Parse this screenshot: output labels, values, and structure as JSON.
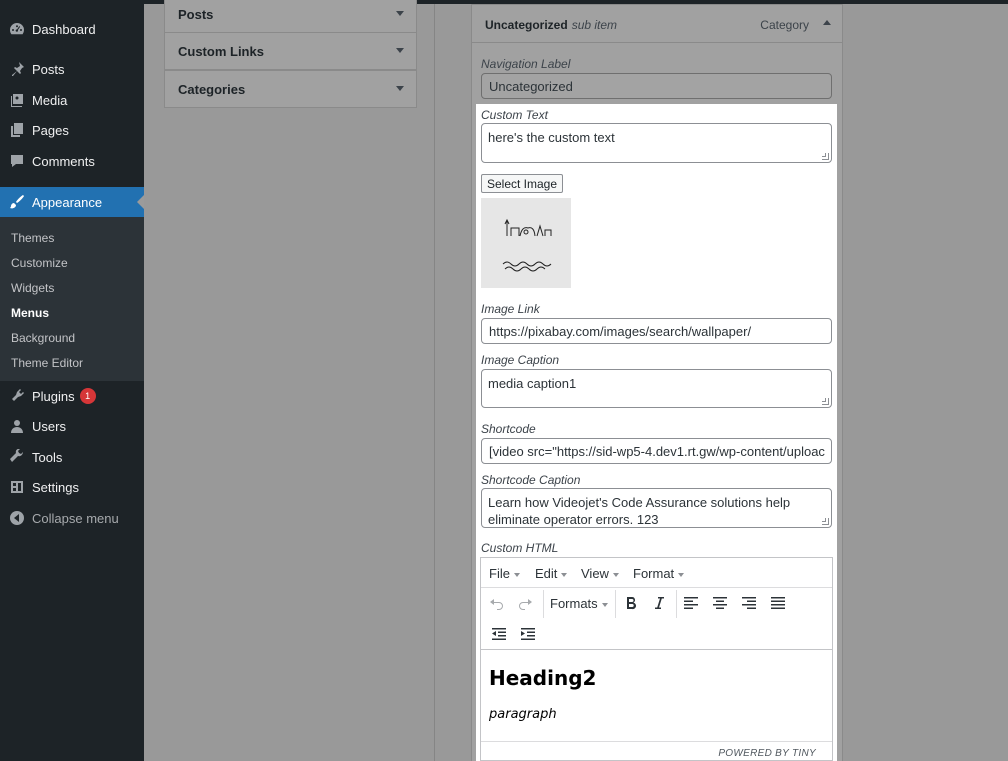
{
  "sidebar": {
    "items": [
      {
        "label": "Dashboard",
        "icon": "dashboard-icon"
      },
      {
        "label": "Posts",
        "icon": "pin-icon"
      },
      {
        "label": "Media",
        "icon": "media-icon"
      },
      {
        "label": "Pages",
        "icon": "pages-icon"
      },
      {
        "label": "Comments",
        "icon": "comment-icon"
      },
      {
        "label": "Appearance",
        "icon": "brush-icon"
      },
      {
        "label": "Plugins",
        "icon": "plugin-icon",
        "badge": "1"
      },
      {
        "label": "Users",
        "icon": "user-icon"
      },
      {
        "label": "Tools",
        "icon": "wrench-icon"
      },
      {
        "label": "Settings",
        "icon": "settings-icon"
      },
      {
        "label": "Collapse menu",
        "icon": "collapse-icon"
      }
    ],
    "submenu": [
      "Themes",
      "Customize",
      "Widgets",
      "Menus",
      "Background",
      "Theme Editor"
    ],
    "active_color": "#2271b1"
  },
  "accordion": {
    "sections": [
      "Posts",
      "Custom Links",
      "Categories"
    ]
  },
  "menu_item": {
    "title": "Uncategorized",
    "subtitle": "sub item",
    "type": "Category",
    "nav_label_label": "Navigation Label",
    "nav_label_value": "Uncategorized",
    "custom_text_label": "Custom Text",
    "custom_text_value": "here's the custom text",
    "select_image_label": "Select Image",
    "image_link_label": "Image Link",
    "image_link_value": "https://pixabay.com/images/search/wallpaper/",
    "image_caption_label": "Image Caption",
    "image_caption_value": "media caption1",
    "shortcode_label": "Shortcode",
    "shortcode_value": "[video src=\"https://sid-wp5-4.dev1.rt.gw/wp-content/uploac",
    "shortcode_caption_label": "Shortcode Caption",
    "shortcode_caption_value": "Learn how Videojet's Code Assurance solutions help eliminate operator errors. 123",
    "custom_html_label": "Custom HTML"
  },
  "editor": {
    "menus": [
      "File",
      "Edit",
      "View",
      "Format"
    ],
    "formats_label": "Formats",
    "heading": "Heading2",
    "paragraph": "paragraph",
    "powered": "POWERED BY TINY"
  }
}
